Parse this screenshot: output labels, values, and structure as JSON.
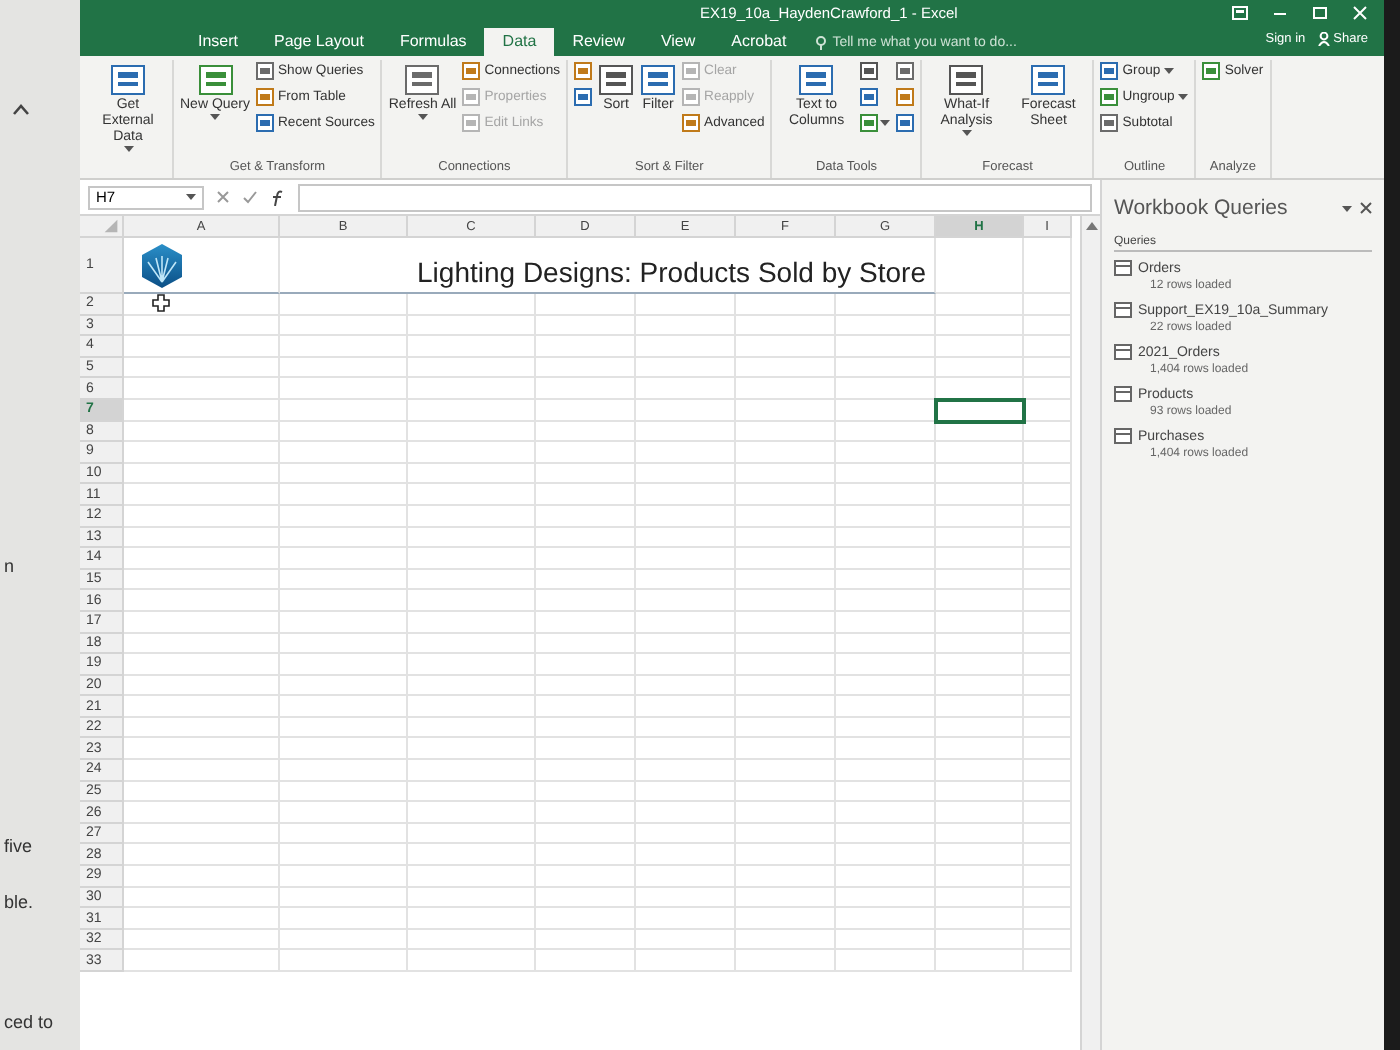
{
  "side_strip": {
    "texts": [
      "n",
      "five",
      "ble.",
      "ced to"
    ]
  },
  "window": {
    "title": "EX19_10a_HaydenCrawford_1 - Excel",
    "sign_in": "Sign in",
    "share": "Share"
  },
  "tabs": [
    {
      "label": "Insert",
      "selected": false
    },
    {
      "label": "Page Layout",
      "selected": false
    },
    {
      "label": "Formulas",
      "selected": false
    },
    {
      "label": "Data",
      "selected": true
    },
    {
      "label": "Review",
      "selected": false
    },
    {
      "label": "View",
      "selected": false
    },
    {
      "label": "Acrobat",
      "selected": false
    }
  ],
  "tell_me": {
    "placeholder": "Tell me what you want to do..."
  },
  "ribbon": {
    "groups": [
      {
        "commands": [
          {
            "kind": "large",
            "label": "Get External Data",
            "dropdown": true,
            "disabled": false
          }
        ]
      },
      {
        "label": "Get & Transform",
        "commands": [
          {
            "kind": "large",
            "label": "New Query",
            "dropdown": true,
            "disabled": false
          },
          {
            "kind": "small",
            "label": "Show Queries",
            "dropdown": false,
            "disabled": false
          },
          {
            "kind": "small",
            "label": "From Table",
            "dropdown": false,
            "disabled": false
          },
          {
            "kind": "small",
            "label": "Recent Sources",
            "dropdown": false,
            "disabled": false
          }
        ]
      },
      {
        "label": "Connections",
        "commands": [
          {
            "kind": "large",
            "label": "Refresh All",
            "dropdown": true,
            "disabled": false
          },
          {
            "kind": "small",
            "label": "Connections",
            "dropdown": false,
            "disabled": false
          },
          {
            "kind": "small",
            "label": "Properties",
            "dropdown": false,
            "disabled": true
          },
          {
            "kind": "small",
            "label": "Edit Links",
            "dropdown": false,
            "disabled": true
          }
        ]
      },
      {
        "label": "Sort & Filter",
        "commands": [
          {
            "kind": "icon",
            "dropdown": false,
            "disabled": false
          },
          {
            "kind": "icon",
            "dropdown": false,
            "disabled": false
          },
          {
            "kind": "large",
            "label": "Sort",
            "dropdown": false,
            "disabled": false
          },
          {
            "kind": "large",
            "label": "Filter",
            "dropdown": false,
            "disabled": false
          },
          {
            "kind": "small",
            "label": "Clear",
            "dropdown": false,
            "disabled": true
          },
          {
            "kind": "small",
            "label": "Reapply",
            "dropdown": false,
            "disabled": true
          },
          {
            "kind": "small",
            "label": "Advanced",
            "dropdown": false,
            "disabled": false
          }
        ]
      },
      {
        "label": "Data Tools",
        "commands": [
          {
            "kind": "large",
            "label": "Text to Columns",
            "dropdown": false,
            "disabled": false
          },
          {
            "kind": "icon",
            "dropdown": false,
            "disabled": false
          },
          {
            "kind": "icon",
            "dropdown": false,
            "disabled": false
          },
          {
            "kind": "icon",
            "dropdown": true,
            "disabled": false
          },
          {
            "kind": "icon",
            "dropdown": false,
            "disabled": false
          },
          {
            "kind": "icon",
            "dropdown": false,
            "disabled": false
          },
          {
            "kind": "icon",
            "dropdown": false,
            "disabled": false
          }
        ]
      },
      {
        "label": "Forecast",
        "commands": [
          {
            "kind": "large",
            "label": "What-If Analysis",
            "dropdown": true,
            "disabled": false
          },
          {
            "kind": "large",
            "label": "Forecast Sheet",
            "dropdown": false,
            "disabled": false
          }
        ]
      },
      {
        "label": "Outline",
        "commands": [
          {
            "kind": "small",
            "label": "Group",
            "dropdown": true,
            "disabled": false
          },
          {
            "kind": "small",
            "label": "Ungroup",
            "dropdown": true,
            "disabled": false
          },
          {
            "kind": "small",
            "label": "Subtotal",
            "dropdown": false,
            "disabled": false
          }
        ]
      },
      {
        "label": "Analyze",
        "commands": [
          {
            "kind": "small",
            "label": "Solver",
            "dropdown": false,
            "disabled": false
          }
        ]
      }
    ]
  },
  "formula_bar": {
    "name_box": "H7"
  },
  "sheet": {
    "title": "Lighting Designs: Products Sold by Store",
    "columns": [
      {
        "label": "A",
        "selected": false
      },
      {
        "label": "B",
        "selected": false
      },
      {
        "label": "C",
        "selected": false
      },
      {
        "label": "D",
        "selected": false
      },
      {
        "label": "E",
        "selected": false
      },
      {
        "label": "F",
        "selected": false
      },
      {
        "label": "G",
        "selected": false
      },
      {
        "label": "H",
        "selected": true
      },
      {
        "label": "I",
        "selected": false
      }
    ],
    "rows": [
      {
        "label": "1",
        "selected": false
      },
      {
        "label": "2",
        "selected": false
      },
      {
        "label": "3",
        "selected": false
      },
      {
        "label": "4",
        "selected": false
      },
      {
        "label": "5",
        "selected": false
      },
      {
        "label": "6",
        "selected": false
      },
      {
        "label": "7",
        "selected": true
      },
      {
        "label": "8",
        "selected": false
      },
      {
        "label": "9",
        "selected": false
      },
      {
        "label": "10",
        "selected": false
      },
      {
        "label": "11",
        "selected": false
      },
      {
        "label": "12",
        "selected": false
      },
      {
        "label": "13",
        "selected": false
      },
      {
        "label": "14",
        "selected": false
      },
      {
        "label": "15",
        "selected": false
      },
      {
        "label": "16",
        "selected": false
      },
      {
        "label": "17",
        "selected": false
      },
      {
        "label": "18",
        "selected": false
      },
      {
        "label": "19",
        "selected": false
      },
      {
        "label": "20",
        "selected": false
      },
      {
        "label": "21",
        "selected": false
      },
      {
        "label": "22",
        "selected": false
      },
      {
        "label": "23",
        "selected": false
      },
      {
        "label": "24",
        "selected": false
      },
      {
        "label": "25",
        "selected": false
      },
      {
        "label": "26",
        "selected": false
      },
      {
        "label": "27",
        "selected": false
      },
      {
        "label": "28",
        "selected": false
      },
      {
        "label": "29",
        "selected": false
      },
      {
        "label": "30",
        "selected": false
      },
      {
        "label": "31",
        "selected": false
      },
      {
        "label": "32",
        "selected": false
      },
      {
        "label": "33",
        "selected": false
      }
    ]
  },
  "queries_pane": {
    "title": "Workbook Queries",
    "section": "Queries",
    "items": [
      {
        "name": "Orders",
        "status": "12 rows loaded"
      },
      {
        "name": "Support_EX19_10a_Summary",
        "status": "22 rows loaded"
      },
      {
        "name": "2021_Orders",
        "status": "1,404 rows loaded"
      },
      {
        "name": "Products",
        "status": "93 rows loaded"
      },
      {
        "name": "Purchases",
        "status": "1,404 rows loaded"
      }
    ]
  }
}
